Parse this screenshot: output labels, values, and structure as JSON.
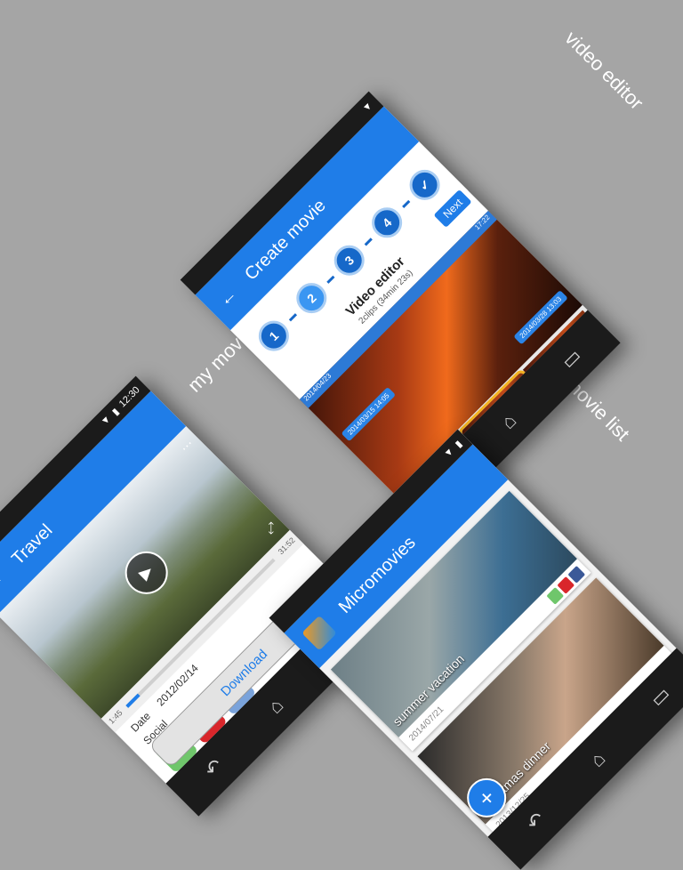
{
  "captions": {
    "video_editor": "video editor",
    "my_movie": "my movie",
    "movie_list": "movie list"
  },
  "editor": {
    "appbar_title": "Create movie",
    "next_label": "Next",
    "steps": [
      "1",
      "2",
      "3",
      "4",
      "✓"
    ],
    "title": "Video editor",
    "subtitle": "2clips (34min 23s)",
    "date_left": "2014/04/23",
    "time_right": "17:22",
    "tag_start": "2014/03/15 14:05",
    "tag_end": "2014/03/28 13:03"
  },
  "mymovie": {
    "status_time": "12:30",
    "appbar_title": "Travel",
    "time_elapsed": "1:45",
    "time_total": "31:52",
    "progress_fraction": 0.08,
    "date_label": "Date",
    "date_value": "2012/02/14",
    "social_label": "Social",
    "line_label": "LINE",
    "fb_label": "f",
    "download_label": "Download"
  },
  "list": {
    "appbar_title": "Micromovies",
    "items": [
      {
        "title": "summer vacation",
        "date": "2014/07/21"
      },
      {
        "title": "Christmas dinner",
        "date": "2013/12/25"
      }
    ],
    "fab_label": "+"
  },
  "colors": {
    "accent": "#1f7de8",
    "background": "#a5a5a5"
  }
}
